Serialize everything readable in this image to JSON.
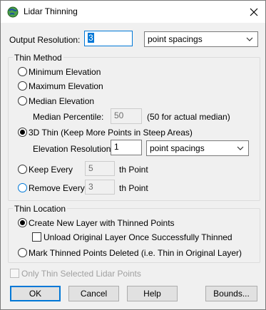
{
  "window": {
    "title": "Lidar Thinning"
  },
  "output_resolution": {
    "label": "Output Resolution:",
    "value": "3",
    "unit": "point spacings"
  },
  "thin_method": {
    "legend": "Thin Method",
    "options": [
      {
        "label": "Minimum Elevation"
      },
      {
        "label": "Maximum Elevation"
      },
      {
        "label": "Median Elevation"
      },
      {
        "label": "3D Thin (Keep More Points in Steep Areas)"
      },
      {
        "label": "Keep Every"
      },
      {
        "label": "Remove Every"
      }
    ],
    "selected": "3D Thin (Keep More Points in Steep Areas)",
    "median_percentile": {
      "label": "Median Percentile:",
      "value": "50",
      "note": "(50 for actual median)"
    },
    "elevation_resolution": {
      "label": "Elevation Resolution:",
      "value": "1",
      "unit": "point spacings"
    },
    "keep_every": {
      "value": "5",
      "suffix": "th Point"
    },
    "remove_every": {
      "value": "3",
      "suffix": "th Point"
    }
  },
  "thin_location": {
    "legend": "Thin Location",
    "create_new_layer": "Create New Layer with Thinned Points",
    "unload_original": "Unload Original Layer Once Successfully Thinned",
    "mark_deleted": "Mark Thinned Points Deleted (i.e. Thin in Original Layer)",
    "selected": "Create New Layer with Thinned Points"
  },
  "only_selected": "Only Thin Selected Lidar Points",
  "buttons": {
    "ok": "OK",
    "cancel": "Cancel",
    "help": "Help",
    "bounds": "Bounds..."
  },
  "colors": {
    "accent": "#0078d7",
    "dialog_bg": "#f0f0f0"
  }
}
